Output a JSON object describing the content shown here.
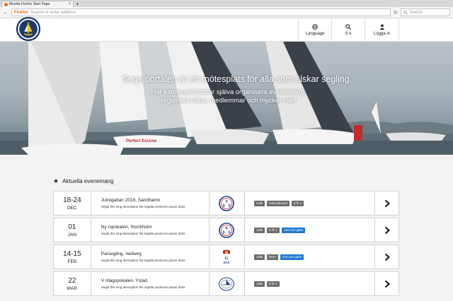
{
  "browser": {
    "tab_title": "Mozilla Firefox Start Page",
    "new_tab": "+",
    "tab_close": "×",
    "url_brand": "Firefox",
    "url_placeholder": "Search or enter address",
    "search_placeholder": "Search"
  },
  "header": {
    "language_label": "Language",
    "search_label": "S k",
    "login_label": "Logga in"
  },
  "hero": {
    "title": "Segelportalen är en mötesplats för alla som älskar segling.",
    "subtitle_line1": "Här kan segelklubbar själva organisera evenemang,",
    "subtitle_line2": "registrera båtar, medlemmar och mycket mer!",
    "boat_label": "Perfect Excuse"
  },
  "events": {
    "heading": "Aktuella evenemang",
    "items": [
      {
        "day": "18-24",
        "month": "DEC",
        "title": "Julregattan 2016, Sandhamn",
        "desc": "Segla this long description fits regatta yeslorum ipsum dolor.",
        "club": "SSS",
        "tags": [
          {
            "label": "Jolle",
            "color": "gray"
          },
          {
            "label": "Internationell",
            "color": "gray"
          },
          {
            "label": "K lb 1",
            "color": "gray"
          }
        ]
      },
      {
        "day": "01",
        "month": "JAN",
        "title": "Ny  rspokalen, Stockholm",
        "desc": "Segla this long description fits regatta yeslorum ipsum dolor.",
        "club": "SSS",
        "tags": [
          {
            "label": "Jolle",
            "color": "gray"
          },
          {
            "label": "K lb 1",
            "color": "gray"
          },
          {
            "label": "Anm lan  ppen",
            "color": "blue"
          }
        ]
      },
      {
        "day": "14-15",
        "month": "FEB",
        "title": "Parsegling, Varberg",
        "desc": "Segla this long description fits regatta yeslorum ipsum dolor.",
        "club": "GKSS",
        "tags": [
          {
            "label": "Jolle",
            "color": "gray"
          },
          {
            "label": "Barn",
            "color": "gray"
          },
          {
            "label": "Anm lan  ppen",
            "color": "blue"
          }
        ]
      },
      {
        "day": "22",
        "month": "MAR",
        "title": "V  rdagspokalen, Ystad",
        "desc": "Segla this long description fits regatta yeslorum ipsum dolor.",
        "club": "",
        "tags": [
          {
            "label": "Jolle",
            "color": "gray"
          },
          {
            "label": "K lb 1",
            "color": "gray"
          }
        ]
      }
    ]
  },
  "icons": {
    "globe": "globe-icon",
    "search": "search-icon",
    "user": "user-icon",
    "chevron": "chevron-right-icon",
    "star": "star-icon"
  },
  "colors": {
    "tag_gray": "#6c6c6c",
    "tag_blue": "#1f78d1",
    "firefox_orange": "#e8691d"
  }
}
